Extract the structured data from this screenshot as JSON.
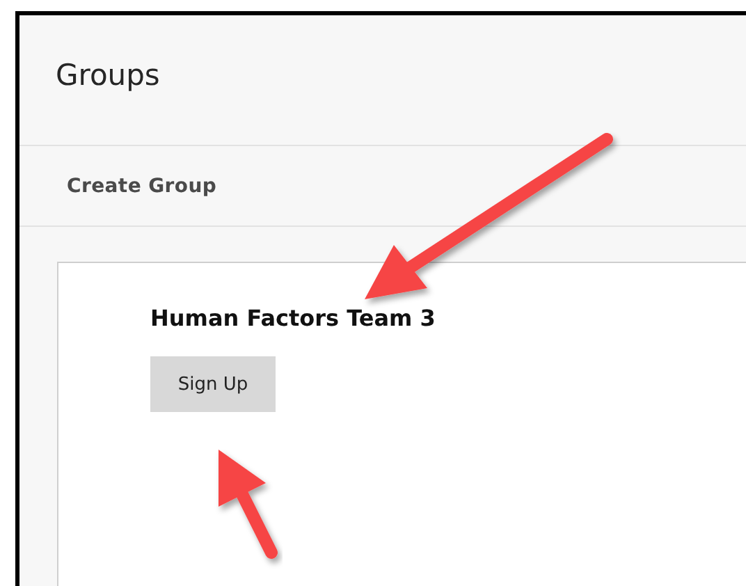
{
  "page": {
    "title": "Groups"
  },
  "toolbar": {
    "action": "Create Group"
  },
  "groups": [
    {
      "name": "Human Factors Team 3",
      "button": "Sign Up"
    }
  ]
}
